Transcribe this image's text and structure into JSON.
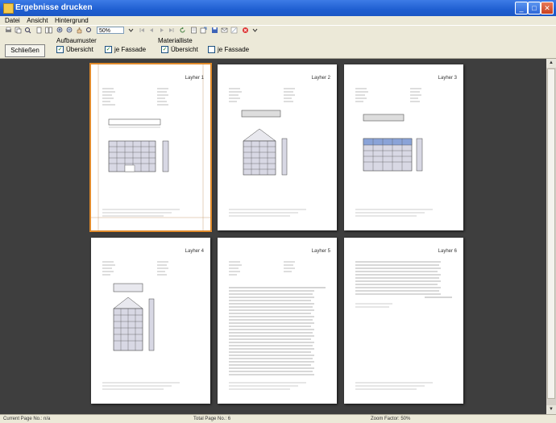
{
  "window": {
    "title": "Ergebnisse drucken"
  },
  "menu": [
    "Datei",
    "Ansicht",
    "Hintergrund"
  ],
  "toolbar": {
    "zoom": "50%"
  },
  "options": {
    "close_label": "Schließen",
    "group1_title": "Aufbaumuster",
    "group2_title": "Materialliste",
    "checks": [
      {
        "label": "Übersicht",
        "checked": true
      },
      {
        "label": "je Fassade",
        "checked": true
      },
      {
        "label": "Übersicht",
        "checked": true
      },
      {
        "label": "je Fassade",
        "checked": false
      }
    ]
  },
  "pages": [
    {
      "title": "Layher 1",
      "selected": true
    },
    {
      "title": "Layher 2",
      "selected": false
    },
    {
      "title": "Layher 3",
      "selected": false
    },
    {
      "title": "Layher 4",
      "selected": false
    },
    {
      "title": "Layher 5",
      "selected": false
    },
    {
      "title": "Layher 6",
      "selected": false
    }
  ],
  "status": {
    "current_page": "Current Page No.: n/a",
    "total_pages": "Total Page No.: 6",
    "zoom": "Zoom Factor: 50%"
  }
}
